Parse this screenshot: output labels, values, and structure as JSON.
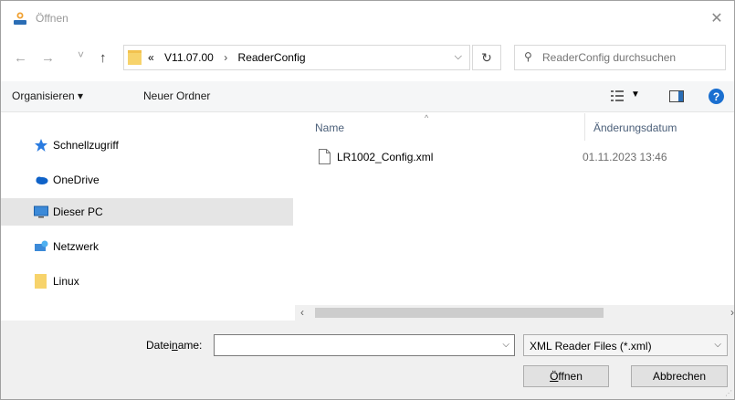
{
  "window": {
    "title": "Öffnen",
    "close_glyph": "✕"
  },
  "nav": {
    "back_glyph": "←",
    "forward_glyph": "→",
    "recent_glyph": "˅",
    "up_glyph": "↑"
  },
  "address": {
    "overflow_glyph": "«",
    "crumbs": [
      "V11.07.00",
      "ReaderConfig"
    ],
    "sep_glyph": "›",
    "dropdown_glyph": "⌵",
    "refresh_glyph": "↻"
  },
  "search": {
    "placeholder": "ReaderConfig durchsuchen",
    "icon_glyph": "⚲"
  },
  "toolbar": {
    "organize_label": "Organisieren ▾",
    "new_folder_label": "Neuer Ordner",
    "view_dd_glyph": "▼",
    "help_glyph": "?"
  },
  "sidebar": {
    "items": [
      {
        "label": "Schnellzugriff",
        "icon": "star-icon"
      },
      {
        "label": "OneDrive",
        "icon": "cloud-icon"
      },
      {
        "label": "Dieser PC",
        "icon": "computer-icon",
        "selected": true
      },
      {
        "label": "Netzwerk",
        "icon": "network-icon"
      },
      {
        "label": "Linux",
        "icon": "folder-icon"
      }
    ]
  },
  "filelist": {
    "sort_glyph": "^",
    "col_name": "Name",
    "col_date": "Änderungsdatum",
    "files": [
      {
        "name": "LR1002_Config.xml",
        "date": "01.11.2023 13:46"
      }
    ],
    "scroll_left": "‹",
    "scroll_right": "›"
  },
  "footer": {
    "filename_label_pre": "Datei",
    "filename_label_u": "n",
    "filename_label_post": "ame:",
    "filename_value": "",
    "filename_dd_glyph": "⌵",
    "filetype_value": "XML Reader Files (*.xml)",
    "filetype_dd_glyph": "⌵",
    "open_label_u": "Ö",
    "open_label_rest": "ffnen",
    "cancel_label": "Abbrechen",
    "grip_glyph": "⋰"
  },
  "colors": {
    "accent": "#1a6fd0",
    "selected_bg": "#e5e5e5",
    "header_text": "#4c607a"
  }
}
